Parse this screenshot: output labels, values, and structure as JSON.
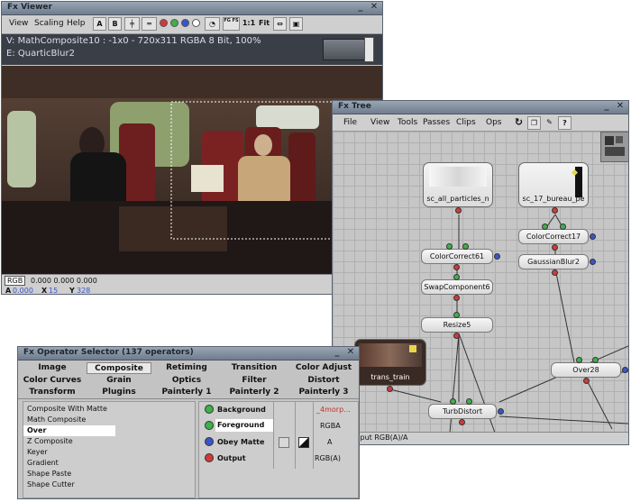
{
  "viewer": {
    "title": "Fx Viewer",
    "menu": [
      "View",
      "Scaling",
      "Help"
    ],
    "toolbar": {
      "a_btn": "A",
      "b_btn": "B",
      "zoom_label": "1:1",
      "fit_label": "Fit",
      "fs_label": "FG FS"
    },
    "info_line1": "V: MathComposite10 : -1x0 - 720x311 RGBA 8 Bit, 100%",
    "info_line2": "E: QuarticBlur2",
    "status": {
      "mode": "RGB",
      "values": "0.000  0.000  0.000",
      "alpha_label": "A",
      "alpha_value": "0.000",
      "x_label": "X",
      "x_value": "15",
      "y_label": "Y",
      "y_value": "328"
    }
  },
  "tree": {
    "title": "Fx Tree",
    "menu": [
      "File",
      "View",
      "Tools",
      "Passes",
      "Clips",
      "Ops"
    ],
    "nodes": {
      "sc_all_particles": "sc_all_particles_n",
      "sc_17_bureau": "sc_17_bureau_pe",
      "colorcorrect61": "ColorCorrect61",
      "colorcorrect17": "ColorCorrect17",
      "gaussianblur2": "GaussianBlur2",
      "swapcomponent6": "SwapComponent6",
      "resize5": "Resize5",
      "trans_train": "trans_train",
      "over28": "Over28",
      "turbdistort": "TurbDistort"
    },
    "status_text": "ort : Input RGB(A)/A"
  },
  "selector": {
    "title": "Fx Operator Selector (137 operators)",
    "tabs_row1": [
      "Image",
      "Composite",
      "Retiming",
      "Transition",
      "Color Adjust"
    ],
    "tabs_row2": [
      "Color Curves",
      "Grain",
      "Optics",
      "Filter",
      "Distort"
    ],
    "tabs_row3": [
      "Transform",
      "Plugins",
      "Painterly 1",
      "Painterly 2",
      "Painterly 3"
    ],
    "active_tab": "Composite",
    "operators": [
      "Composite With Matte",
      "Math Composite",
      "Over",
      "Z Composite",
      "Keyer",
      "Gradient",
      "Shape Paste",
      "Shape Cutter"
    ],
    "selected_operator": "Over",
    "ports": [
      {
        "name": "Background",
        "color": "green",
        "value": "_4morp..."
      },
      {
        "name": "Foreground",
        "color": "green",
        "value": "RGBA"
      },
      {
        "name": "Obey Matte",
        "color": "blue",
        "value": "A"
      },
      {
        "name": "Output",
        "color": "red",
        "value": "RGB(A)"
      }
    ]
  },
  "colors": {
    "accent_green": "#3fb04a",
    "accent_red": "#d03a3a",
    "accent_blue": "#3a55c8",
    "selection": "#ffffff",
    "title_bg": "#7f8c9c"
  }
}
